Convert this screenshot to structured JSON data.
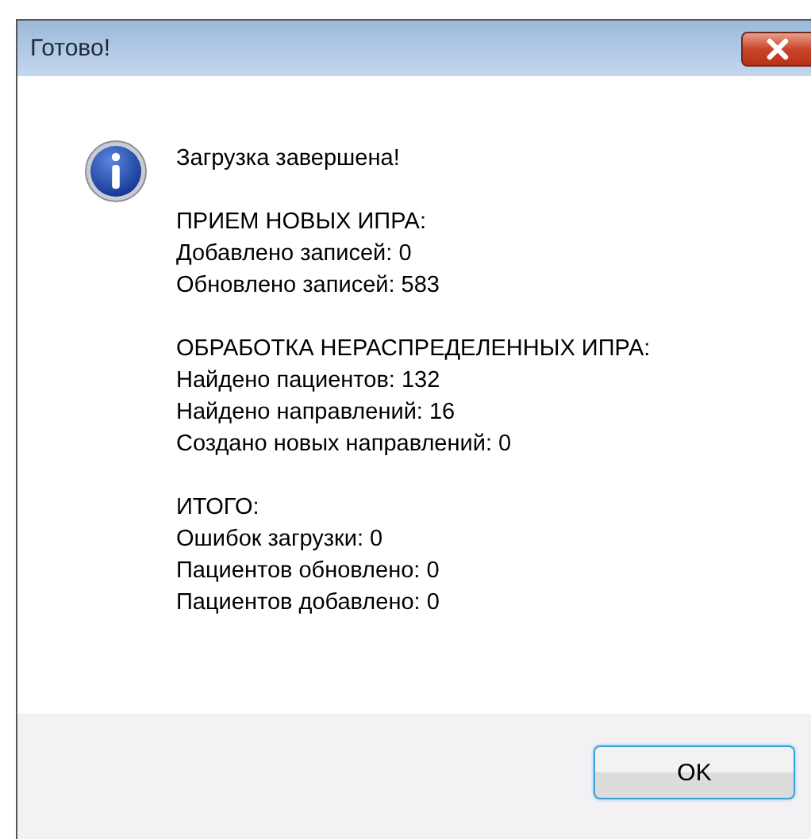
{
  "window": {
    "title": "Готово!"
  },
  "message": [
    [
      "Загрузка завершена!"
    ],
    [
      "ПРИЕМ НОВЫХ ИПРА:",
      "Добавлено записей: 0",
      "Обновлено записей: 583"
    ],
    [
      "ОБРАБОТКА НЕРАСПРЕДЕЛЕННЫХ ИПРА:",
      "Найдено пациентов: 132",
      "Найдено направлений: 16",
      "Создано новых направлений: 0"
    ],
    [
      "ИТОГО:",
      "Ошибок загрузки: 0",
      "Пациентов обновлено: 0",
      "Пациентов добавлено: 0"
    ]
  ],
  "buttons": [
    "OK"
  ]
}
